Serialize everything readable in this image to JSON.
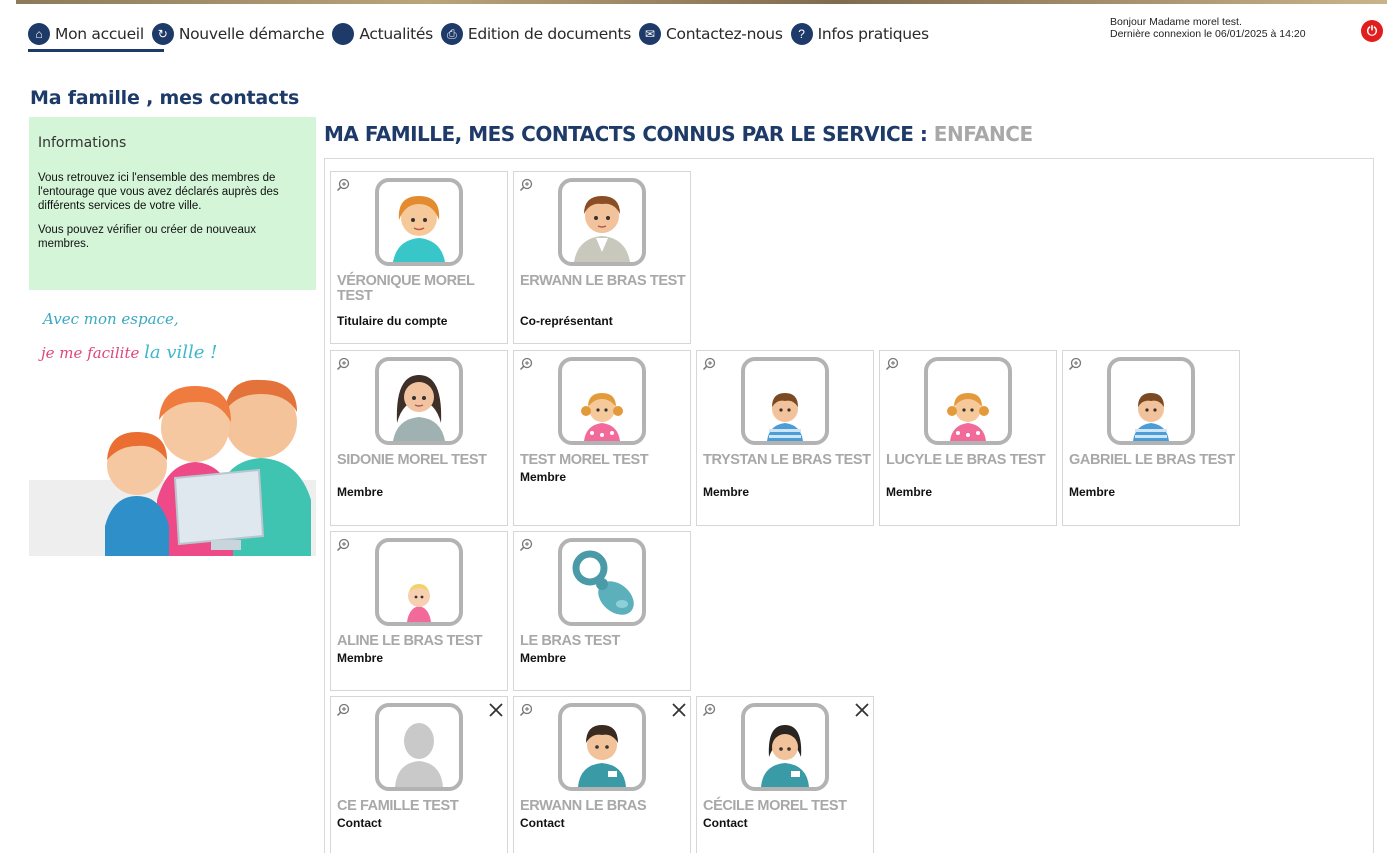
{
  "nav": {
    "items": [
      {
        "label": "Mon accueil",
        "icon": "home-icon"
      },
      {
        "label": "Nouvelle démarche",
        "icon": "new-request-icon"
      },
      {
        "label": "Actualités",
        "icon": "news-icon"
      },
      {
        "label": "Edition de documents",
        "icon": "printer-icon"
      },
      {
        "label": "Contactez-nous",
        "icon": "mail-icon"
      },
      {
        "label": "Infos pratiques",
        "icon": "lightbulb-icon"
      }
    ]
  },
  "user": {
    "greeting": "Bonjour Madame morel test.",
    "last_login": "Dernière connexion le 06/01/2025 à 14:20"
  },
  "page": {
    "title": "Ma famille , mes contacts",
    "section_title": "MA FAMILLE, MES CONTACTS CONNUS PAR LE SERVICE : ",
    "service": "ENFANCE"
  },
  "info": {
    "title": "Informations",
    "text1": "Vous retrouvez ici l'ensemble des membres de l'entourage que vous avez déclarés auprès des différents services de votre ville.",
    "text2": "Vous pouvez vérifier ou créer de nouveaux membres."
  },
  "promo": {
    "line1": "Avec mon espace,",
    "line2_a": "je me facilite ",
    "line2_b": "la ville !"
  },
  "cards": [
    {
      "name": "VÉRONIQUE MOREL TEST",
      "role": "Titulaire du compte",
      "avatar": "woman-avatar",
      "removable": false
    },
    {
      "name": "ERWANN LE BRAS TEST",
      "role": "Co-représentant",
      "avatar": "man-avatar",
      "removable": false
    },
    {
      "name": "SIDONIE MOREL TEST",
      "role": "Membre",
      "avatar": "woman-dark-hair-avatar",
      "removable": false
    },
    {
      "name": "TEST MOREL TEST",
      "role": "Membre",
      "avatar": "girl-avatar",
      "removable": false
    },
    {
      "name": "TRYSTAN LE BRAS TEST",
      "role": "Membre",
      "avatar": "boy-avatar",
      "removable": false
    },
    {
      "name": "LUCYLE LE BRAS TEST",
      "role": "Membre",
      "avatar": "girl-avatar",
      "removable": false
    },
    {
      "name": "GABRIEL LE BRAS TEST",
      "role": "Membre",
      "avatar": "boy-avatar",
      "removable": false
    },
    {
      "name": "ALINE LE BRAS TEST",
      "role": "Membre",
      "avatar": "baby-avatar",
      "removable": false
    },
    {
      "name": "LE BRAS TEST",
      "role": "Membre",
      "avatar": "pacifier-avatar",
      "removable": false
    },
    {
      "name": "CE FAMILLE TEST",
      "role": "Contact",
      "avatar": "silhouette-avatar",
      "removable": true
    },
    {
      "name": "ERWANN LE BRAS",
      "role": "Contact",
      "avatar": "contact-man-avatar",
      "removable": true
    },
    {
      "name": "CÉCILE MOREL TEST",
      "role": "Contact",
      "avatar": "contact-woman-avatar",
      "removable": true
    }
  ],
  "colors": {
    "brand": "#1d3a68",
    "info_bg": "#d4f5d8",
    "logout": "#e11d1d",
    "muted": "#a8a8a8"
  }
}
